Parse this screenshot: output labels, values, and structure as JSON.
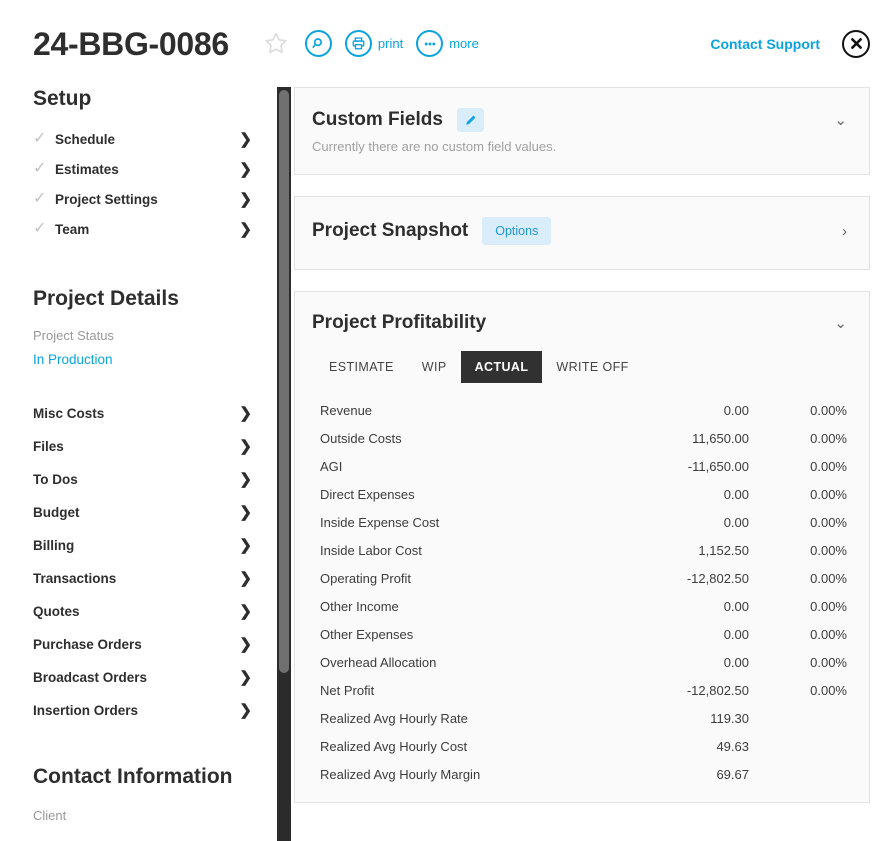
{
  "header": {
    "project_number": "24-BBG-0086",
    "star_icon": "star-outline-icon",
    "search_icon": "magnifier-icon",
    "print_icon": "printer-icon",
    "print_label": "print",
    "more_icon": "ellipsis-icon",
    "more_label": "more",
    "support_label": "Contact Support",
    "close_icon": "close-x-icon",
    "accent_color": "#0aa3e0"
  },
  "sidebar": {
    "setup_heading": "Setup",
    "setup_items": [
      {
        "label": "Schedule",
        "check": "✓",
        "chevron": "❯"
      },
      {
        "label": "Estimates",
        "check": "✓",
        "chevron": "❯"
      },
      {
        "label": "Project Settings",
        "check": "✓",
        "chevron": "❯"
      },
      {
        "label": "Team",
        "check": "✓",
        "chevron": "❯"
      }
    ],
    "details_heading": "Project Details",
    "status_label": "Project Status",
    "status_value": "In Production",
    "status_color": "#0aa3e0",
    "nav_items": [
      {
        "label": "Misc Costs",
        "chevron": "❯"
      },
      {
        "label": "Files",
        "chevron": "❯"
      },
      {
        "label": "To Dos",
        "chevron": "❯"
      },
      {
        "label": "Budget",
        "chevron": "❯"
      },
      {
        "label": "Billing",
        "chevron": "❯"
      },
      {
        "label": "Transactions",
        "chevron": "❯"
      },
      {
        "label": "Quotes",
        "chevron": "❯"
      },
      {
        "label": "Purchase Orders",
        "chevron": "❯"
      },
      {
        "label": "Broadcast Orders",
        "chevron": "❯"
      },
      {
        "label": "Insertion Orders",
        "chevron": "❯"
      }
    ],
    "contact_heading": "Contact Information",
    "contact_sub": "Client"
  },
  "panels": {
    "custom_fields": {
      "title": "Custom Fields",
      "edit_icon": "pencil-icon",
      "empty_text": "Currently there are no custom field values.",
      "toggle_icon": "chevron-down-icon",
      "toggle_glyph": "⌄"
    },
    "project_snapshot": {
      "title": "Project Snapshot",
      "options_label": "Options",
      "toggle_icon": "chevron-right-icon",
      "toggle_glyph": "›"
    },
    "project_profitability": {
      "title": "Project Profitability",
      "toggle_icon": "chevron-down-icon",
      "toggle_glyph": "⌄",
      "tabs": [
        {
          "label": "ESTIMATE",
          "active": false
        },
        {
          "label": "WIP",
          "active": false
        },
        {
          "label": "ACTUAL",
          "active": true
        },
        {
          "label": "WRITE OFF",
          "active": false
        }
      ],
      "active_tab_bg": "#313131",
      "rows": [
        {
          "label": "Revenue",
          "value": "0.00",
          "percent": "0.00%"
        },
        {
          "label": "Outside Costs",
          "value": "11,650.00",
          "percent": "0.00%"
        },
        {
          "label": "AGI",
          "value": "-11,650.00",
          "percent": "0.00%"
        },
        {
          "label": "Direct Expenses",
          "value": "0.00",
          "percent": "0.00%"
        },
        {
          "label": "Inside Expense Cost",
          "value": "0.00",
          "percent": "0.00%"
        },
        {
          "label": "Inside Labor Cost",
          "value": "1,152.50",
          "percent": "0.00%"
        },
        {
          "label": "Operating Profit",
          "value": "-12,802.50",
          "percent": "0.00%"
        },
        {
          "label": "Other Income",
          "value": "0.00",
          "percent": "0.00%"
        },
        {
          "label": "Other Expenses",
          "value": "0.00",
          "percent": "0.00%"
        },
        {
          "label": "Overhead Allocation",
          "value": "0.00",
          "percent": "0.00%"
        },
        {
          "label": "Net Profit",
          "value": "-12,802.50",
          "percent": "0.00%"
        },
        {
          "label": "Realized Avg Hourly Rate",
          "value": "119.30",
          "percent": ""
        },
        {
          "label": "Realized Avg Hourly Cost",
          "value": "49.63",
          "percent": ""
        },
        {
          "label": "Realized Avg Hourly Margin",
          "value": "69.67",
          "percent": ""
        }
      ]
    }
  }
}
